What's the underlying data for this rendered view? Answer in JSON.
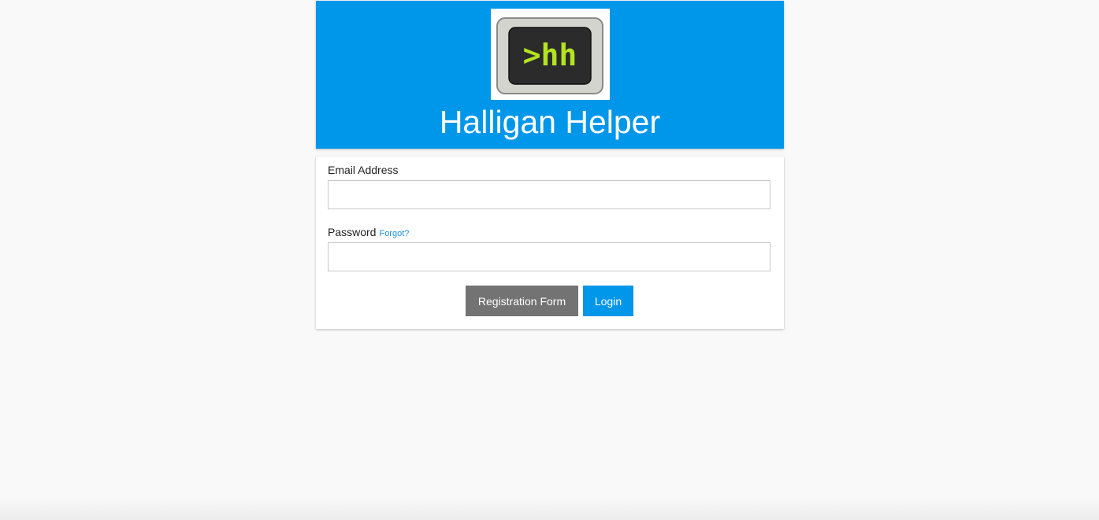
{
  "header": {
    "logo_text": ">hh",
    "title": "Halligan Helper",
    "background_color": "#0096ea"
  },
  "login_form": {
    "email_label": "Email Address",
    "email_value": "",
    "password_label": "Password",
    "forgot_link": "Forgot?",
    "password_value": "",
    "register_button": "Registration Form",
    "login_button": "Login"
  },
  "colors": {
    "accent": "#0096ea",
    "secondary_button": "#737373",
    "link": "#1a8fd8",
    "logo_text": "#b4e31f"
  }
}
